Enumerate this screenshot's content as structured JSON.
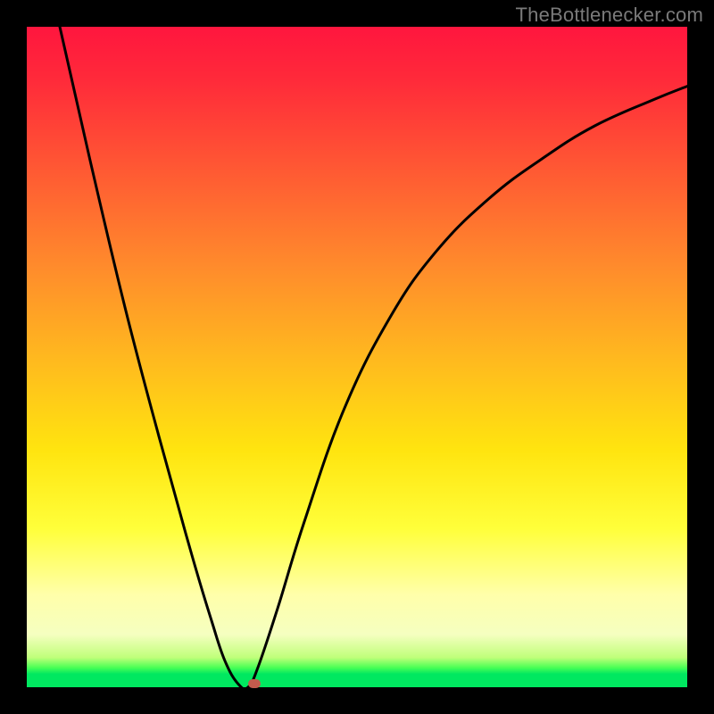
{
  "watermark": "TheBottlenecker.com",
  "chart_data": {
    "type": "line",
    "title": "",
    "xlabel": "",
    "ylabel": "",
    "xlim": [
      0,
      100
    ],
    "ylim": [
      0,
      100
    ],
    "series": [
      {
        "name": "bottleneck-curve",
        "x": [
          5,
          10,
          15,
          20,
          25,
          28,
          30,
          32,
          33.5,
          35,
          38,
          42,
          48,
          55,
          62,
          70,
          78,
          86,
          95,
          100
        ],
        "y": [
          100,
          78,
          57,
          38,
          20,
          10,
          4,
          0.5,
          0,
          3,
          12,
          25,
          42,
          56,
          66,
          74,
          80,
          85,
          89,
          91
        ]
      }
    ],
    "marker": {
      "x": 34.5,
      "y": 0.6,
      "color": "#c25b4d"
    },
    "background_gradient": {
      "stops": [
        {
          "pos": 0.0,
          "color": "#ff163e"
        },
        {
          "pos": 0.5,
          "color": "#ffb81f"
        },
        {
          "pos": 0.76,
          "color": "#ffff3a"
        },
        {
          "pos": 0.95,
          "color": "#c0ff7a"
        },
        {
          "pos": 1.0,
          "color": "#00e860"
        }
      ]
    }
  }
}
